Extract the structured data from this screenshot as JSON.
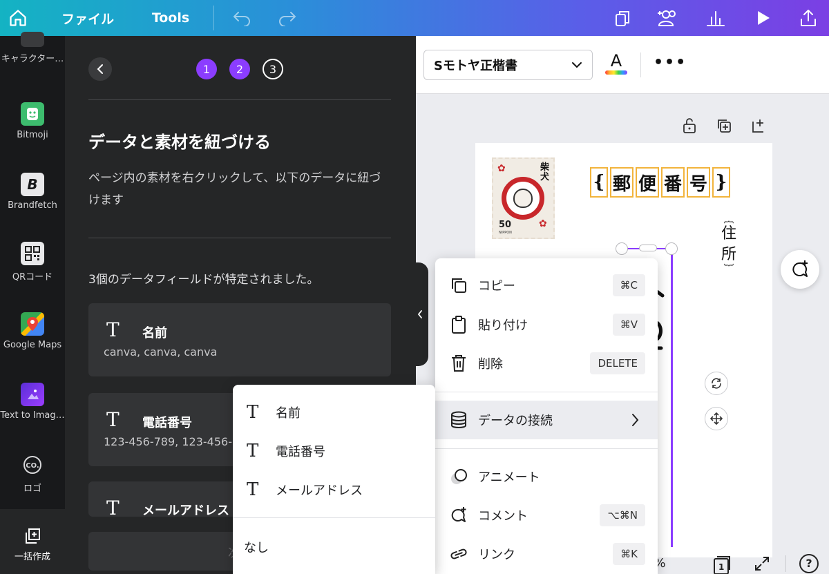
{
  "topbar": {
    "file_label": "ファイル",
    "tools_label": "Tools"
  },
  "rail": {
    "items": [
      {
        "label": "キャラクター…"
      },
      {
        "label": "Bitmoji"
      },
      {
        "label": "Brandfetch"
      },
      {
        "label": "QRコード"
      },
      {
        "label": "Google Maps"
      },
      {
        "label": "Text to Imag…"
      },
      {
        "label": "ロゴ"
      }
    ],
    "bulk_create_label": "一括作成"
  },
  "panel": {
    "steps": [
      "1",
      "2",
      "3"
    ],
    "title": "データと素材を紐づける",
    "description": "ページ内の素材を右クリックして、以下のデータに紐づけます",
    "count_text": "3個のデータフィールドが特定されました。",
    "fields": [
      {
        "name": "名前",
        "values": "canva, canva, canva"
      },
      {
        "name": "電話番号",
        "values": "123-456-789, 123-456-789"
      },
      {
        "name": "メールアドレス",
        "values": ""
      }
    ],
    "next_label": "次へ"
  },
  "font_toolbar": {
    "font_name": "Sモトヤ正楷書",
    "color_letter": "A",
    "more_label": "•••"
  },
  "canvas": {
    "postal_chars": [
      "{",
      "郵",
      "便",
      "番",
      "号",
      "}"
    ],
    "address_chars": [
      "︷",
      "住",
      "所",
      "︸"
    ],
    "stamp": {
      "kanji": "柴犬",
      "value": "50",
      "sub": "NIPPON"
    },
    "zoom_suffix": "%",
    "page_number": "1",
    "help": "?"
  },
  "context_menu": {
    "items": [
      {
        "label": "コピー",
        "shortcut": "⌘C"
      },
      {
        "label": "貼り付け",
        "shortcut": "⌘V"
      },
      {
        "label": "削除",
        "shortcut": "DELETE"
      },
      {
        "label": "データの接続",
        "shortcut": ""
      },
      {
        "label": "アニメート",
        "shortcut": ""
      },
      {
        "label": "コメント",
        "shortcut": "⌥⌘N"
      },
      {
        "label": "リンク",
        "shortcut": "⌘K"
      }
    ]
  },
  "data_submenu": {
    "items": [
      {
        "label": "名前"
      },
      {
        "label": "電話番号"
      },
      {
        "label": "メールアドレス"
      }
    ],
    "none_label": "なし"
  },
  "colors": {
    "accent": "#8b3dff",
    "panel_bg": "#252627",
    "rail_bg": "#18191b",
    "highlight_box": "#f2b43c"
  }
}
